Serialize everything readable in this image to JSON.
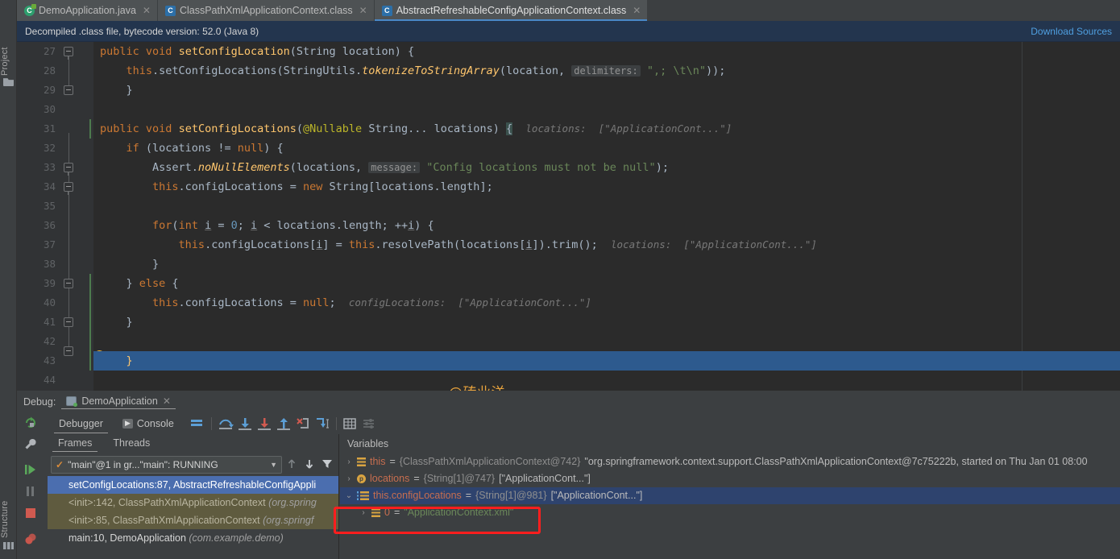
{
  "leftstrip": {
    "project_label": "Project",
    "structure_label": "Structure"
  },
  "tabs": [
    {
      "label": "DemoApplication.java",
      "icon": "java-class-icon",
      "active": false
    },
    {
      "label": "ClassPathXmlApplicationContext.class",
      "icon": "class-file-icon",
      "active": false
    },
    {
      "label": "AbstractRefreshableConfigApplicationContext.class",
      "icon": "class-file-icon",
      "active": true
    }
  ],
  "notice": {
    "text": "Decompiled .class file, bytecode version: 52.0 (Java 8)",
    "link": "Download Sources"
  },
  "editor": {
    "first_line": 27,
    "current_line": 43,
    "lines": [
      {
        "n": 27,
        "text": "public void setConfigLocation(String location) {"
      },
      {
        "n": 28,
        "text": "    this.setConfigLocations(StringUtils.tokenizeToStringArray(location,  delimiters: \",; \\t\\n\"));"
      },
      {
        "n": 29,
        "text": "}"
      },
      {
        "n": 30,
        "text": ""
      },
      {
        "n": 31,
        "text": "public void setConfigLocations(@Nullable String... locations) {   locations: [\"ApplicationCont...\"]"
      },
      {
        "n": 32,
        "text": "    if (locations != null) {"
      },
      {
        "n": 33,
        "text": "        Assert.noNullElements(locations,  message: \"Config locations must not be null\");"
      },
      {
        "n": 34,
        "text": "        this.configLocations = new String[locations.length];"
      },
      {
        "n": 35,
        "text": ""
      },
      {
        "n": 36,
        "text": "        for(int i = 0; i < locations.length; ++i) {"
      },
      {
        "n": 37,
        "text": "            this.configLocations[i] = this.resolvePath(locations[i]).trim();   locations: [\"ApplicationCont...\"]"
      },
      {
        "n": 38,
        "text": "        }"
      },
      {
        "n": 39,
        "text": "    } else {"
      },
      {
        "n": 40,
        "text": "        this.configLocations = null;   configLocations: [\"ApplicationCont...\"]"
      },
      {
        "n": 41,
        "text": "    }"
      },
      {
        "n": 42,
        "text": ""
      },
      {
        "n": 43,
        "text": "}"
      },
      {
        "n": 44,
        "text": ""
      }
    ],
    "hints": {
      "delimiters_label": "delimiters:",
      "delimiters_value": "\",; \\t\\n\"",
      "message_label": "message:",
      "message_value": "\"Config locations must not be null\"",
      "locations_hint": "locations:  [\"ApplicationCont...\"]",
      "configlocations_hint": "configLocations:  [\"ApplicationCont...\"]"
    },
    "watermark": "@砖业洋__"
  },
  "debug": {
    "header_label": "Debug:",
    "run_config": "DemoApplication",
    "toolbar_tabs": [
      {
        "label": "Debugger",
        "active": true
      },
      {
        "label": "Console",
        "active": false
      }
    ],
    "toolbar_icons": [
      "layout-icon",
      "step-over-icon",
      "step-into-icon",
      "force-step-into-icon",
      "step-out-icon",
      "drop-frame-icon",
      "run-to-cursor-icon",
      "evaluate-expression-icon",
      "settings-icon"
    ],
    "left_controls": [
      "rerun-icon",
      "wrench-icon",
      "resume-icon",
      "pause-icon",
      "stop-icon",
      "mute-breakpoints-icon"
    ],
    "frames": {
      "subtabs": [
        {
          "label": "Frames",
          "active": true
        },
        {
          "label": "Threads",
          "active": false
        }
      ],
      "thread_selector": "\"main\"@1 in gr...\"main\": RUNNING",
      "items": [
        {
          "text": "setConfigLocations:87, AbstractRefreshableConfigAppli",
          "pkg": "",
          "state": "selected"
        },
        {
          "text": "<init>:142, ClassPathXmlApplicationContext ",
          "pkg": "(org.spring",
          "state": "lib"
        },
        {
          "text": "<init>:85, ClassPathXmlApplicationContext ",
          "pkg": "(org.springf",
          "state": "lib"
        },
        {
          "text": "main:10, DemoApplication ",
          "pkg": "(com.example.demo)",
          "state": "normal"
        }
      ]
    },
    "variables": {
      "title": "Variables",
      "rows": [
        {
          "arrow": "›",
          "icon": "field-icon",
          "name": "this",
          "eq": " = ",
          "ref": "{ClassPathXmlApplicationContext@742}",
          "value": " \"org.springframework.context.support.ClassPathXmlApplicationContext@7c75222b, started on Thu Jan 01 08:00",
          "value_color": "plain",
          "indent": 0,
          "selected": false
        },
        {
          "arrow": "›",
          "icon": "param-icon",
          "name": "locations",
          "eq": " = ",
          "ref": "{String[1]@747}",
          "value": " [\"ApplicationCont...\"]",
          "value_color": "plain",
          "indent": 0,
          "selected": false
        },
        {
          "arrow": "⌄",
          "icon": "array-icon",
          "name": "this.configLocations",
          "eq": " = ",
          "ref": "{String[1]@981}",
          "value": " [\"ApplicationCont...\"]",
          "value_color": "plain",
          "indent": 0,
          "selected": true
        },
        {
          "arrow": "›",
          "icon": "field-icon",
          "name": "0",
          "eq": " = ",
          "ref": "",
          "value": "\"ApplicationContext.xml\"",
          "value_color": "string",
          "indent": 1,
          "selected": false
        }
      ]
    }
  },
  "colors": {
    "accent_blue": "#4b6eaf",
    "editor_bg": "#2b2b2b",
    "panel_bg": "#3c3f41",
    "keyword": "#cc7832",
    "string": "#6a8759",
    "method": "#ffc66d",
    "field": "#9876aa",
    "number": "#6897bb",
    "annotation": "#bbb529",
    "highlight_red": "#ff1e1e",
    "watermark": "#e8a33d",
    "link": "#4f9fe0"
  }
}
